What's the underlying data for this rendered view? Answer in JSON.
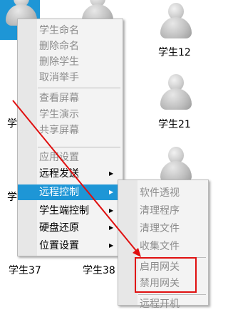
{
  "students": {
    "s12": "学生12",
    "s21": "学生21",
    "s37": "学生37",
    "s38": "学生38",
    "partial_a": "学",
    "partial_b": "学",
    "partial_c": "学"
  },
  "context_menu": {
    "items": [
      {
        "label": "学生命名",
        "enabled": false
      },
      {
        "label": "删除命名",
        "enabled": false
      },
      {
        "label": "删除学生",
        "enabled": false
      },
      {
        "label": "取消举手",
        "enabled": false
      },
      {
        "label": "查看屏幕",
        "enabled": false
      },
      {
        "label": "学生演示",
        "enabled": false
      },
      {
        "label": "共享屏幕",
        "enabled": false
      },
      {
        "label": "应用设置",
        "enabled": false
      },
      {
        "label": "远程发送",
        "enabled": true,
        "submenu": true
      },
      {
        "label": "远程控制",
        "enabled": true,
        "submenu": true,
        "highlighted": true
      },
      {
        "label": "学生端控制",
        "enabled": true,
        "submenu": true
      },
      {
        "label": "硬盘还原",
        "enabled": true,
        "submenu": true
      },
      {
        "label": "位置设置",
        "enabled": true,
        "submenu": true
      }
    ],
    "submenu_arrow": "▶"
  },
  "remote_control_submenu": {
    "items": [
      {
        "label": "软件透视"
      },
      {
        "label": "清理程序"
      },
      {
        "label": "清理文件"
      },
      {
        "label": "收集文件"
      },
      {
        "label": "启用网关"
      },
      {
        "label": "禁用网关"
      },
      {
        "label": "远程开机"
      }
    ]
  },
  "colors": {
    "highlight": "#1e96d6",
    "annotation": "#e01010"
  }
}
